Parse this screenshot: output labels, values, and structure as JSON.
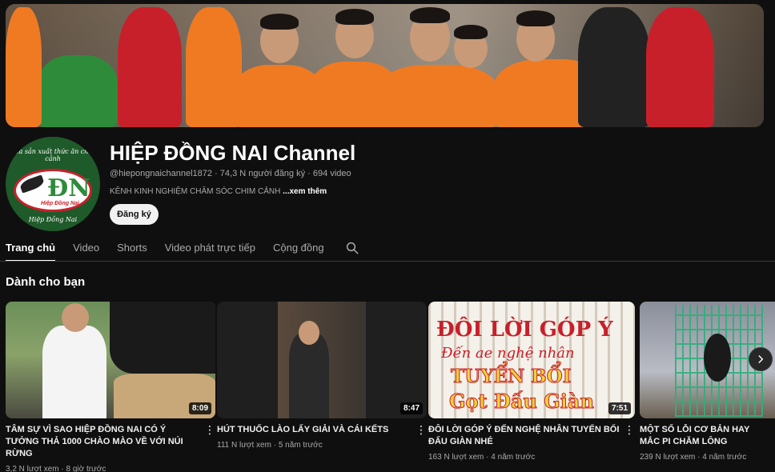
{
  "channel": {
    "name": "HIỆP ĐỒNG NAI Channel",
    "handle": "@hiepongnaichannel1872",
    "subscribers": "74,3 N người đăng ký",
    "video_count": "694 video",
    "meta_sep": "·",
    "description": "KÊNH KINH NGHIỆM CHĂM SÓC CHIM CẢNH",
    "more_link": "...xem thêm",
    "subscribe_label": "Đăng ký",
    "avatar_text_top": "Nhà sản xuất thức ăn chim cảnh",
    "avatar_text_bottom": "Hiệp Đồng Nai",
    "avatar_monogram": "ĐN",
    "avatar_logo_name": "Hiệp Đồng Nai"
  },
  "tabs": [
    {
      "label": "Trang chủ",
      "active": true
    },
    {
      "label": "Video",
      "active": false
    },
    {
      "label": "Shorts",
      "active": false
    },
    {
      "label": "Video phát trực tiếp",
      "active": false
    },
    {
      "label": "Cộng đồng",
      "active": false
    }
  ],
  "section": {
    "title": "Dành cho bạn"
  },
  "videos": [
    {
      "title": "TÂM SỰ VÌ SAO HIỆP ĐỒNG NAI CÓ Ý TƯỞNG THẢ 1000 CHÀO MÀO VỀ VỚI NÚI RỪNG",
      "duration": "8:09",
      "views": "3,2 N lượt xem",
      "age": "8 giờ trước"
    },
    {
      "title": "HÚT THUỐC LÀO LẤY GIẢI VÀ CÁI KẾTS",
      "duration": "8:47",
      "views": "111 N lượt xem",
      "age": "5 năm trước"
    },
    {
      "title": "ĐÔI LỜI GÓP Ý ĐẾN NGHỆ NHÂN TUYỂN BỔI ĐẤU GIÀN NHÉ",
      "duration": "7:51",
      "views": "163 N lượt xem",
      "age": "4 năm trước",
      "thumb_lines": [
        "ĐÔI LỜI GÓP Ý",
        "Đến ae nghệ nhân",
        "TUYỂN BỔI",
        "Gọt Đấu Giàn"
      ]
    },
    {
      "title": "MỘT SỐ LỖI CƠ BẢN HAY MẮC PI CHĂM LÔNG",
      "duration": "",
      "views": "239 N lượt xem",
      "age": "4 năm trước"
    }
  ],
  "icons": {
    "search": "search-icon",
    "more": "more-vert-icon",
    "next": "chevron-right-icon"
  },
  "colors": {
    "background": "#0f0f0f",
    "text_primary": "#f1f1f1",
    "text_secondary": "#aaaaaa",
    "subscribe_bg": "#f1f1f1",
    "shirt_orange": "#f07a22",
    "shirt_green": "#2e8b3a"
  }
}
